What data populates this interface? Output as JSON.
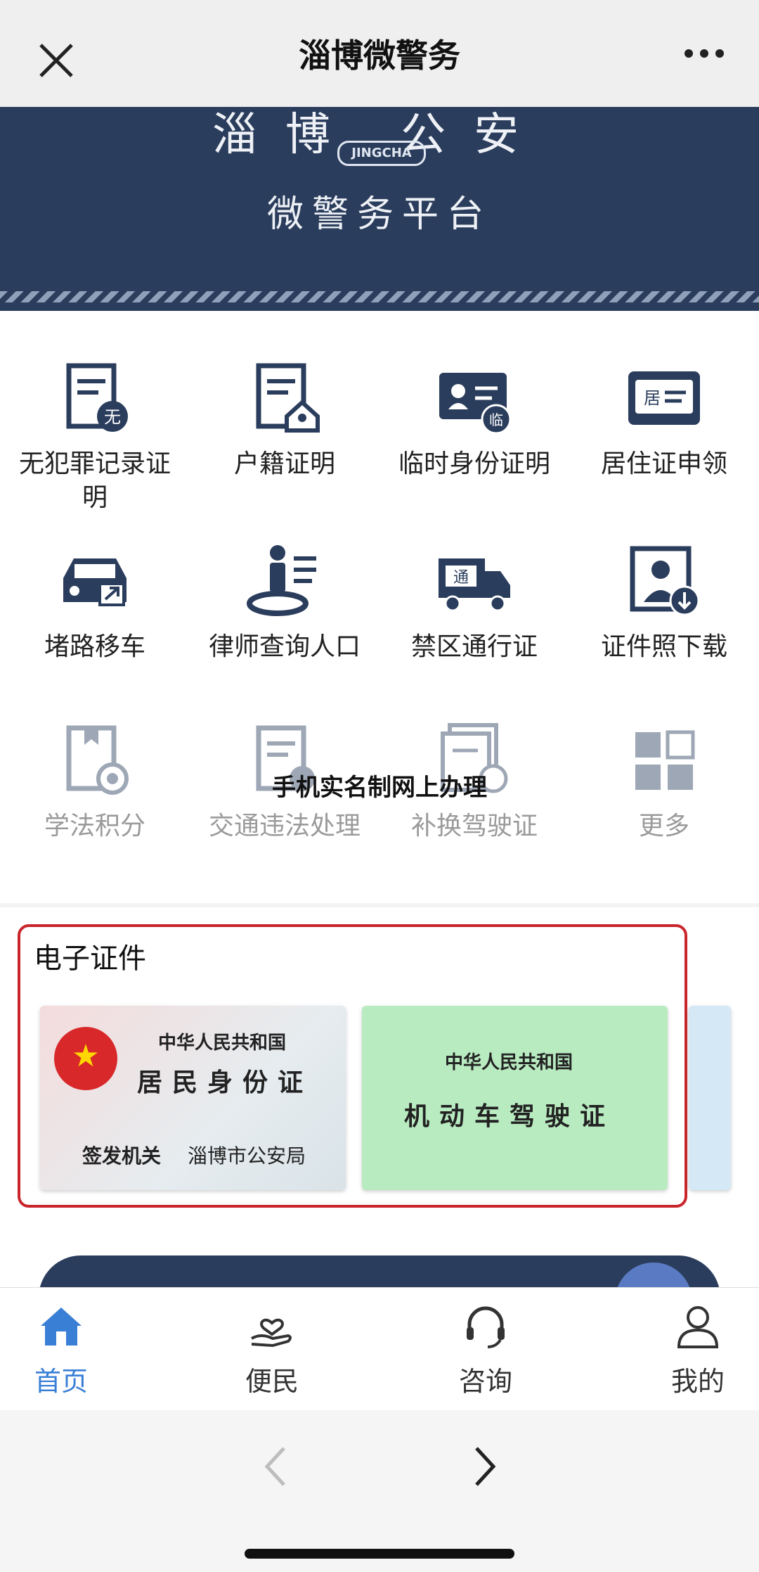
{
  "header": {
    "title": "淄博微警务",
    "close_icon": "close-icon",
    "more_icon": "more-icon"
  },
  "banner": {
    "line1": "淄博 公安",
    "badge": "JINGCHA",
    "line2": "微警务平台"
  },
  "services": [
    {
      "label": "无犯罪记录证明",
      "icon": "no-crime-record-icon"
    },
    {
      "label": "户籍证明",
      "icon": "household-cert-icon"
    },
    {
      "label": "临时身份证明",
      "icon": "temp-id-icon"
    },
    {
      "label": "居住证申领",
      "icon": "residence-permit-icon"
    },
    {
      "label": "堵路移车",
      "icon": "move-car-icon"
    },
    {
      "label": "律师查询人口",
      "icon": "lawyer-query-icon"
    },
    {
      "label": "禁区通行证",
      "icon": "truck-pass-icon"
    },
    {
      "label": "证件照下载",
      "icon": "photo-download-icon"
    },
    {
      "label": "学法积分",
      "icon": "law-points-icon"
    },
    {
      "label": "交通违法处理",
      "icon": "traffic-violation-icon"
    },
    {
      "label": "补换驾驶证",
      "icon": "license-replace-icon"
    },
    {
      "label": "更多",
      "icon": "more-grid-icon"
    }
  ],
  "overlay_caption": "手机实名制网上办理",
  "ecert": {
    "title": "电子证件",
    "id_card": {
      "country": "中华人民共和国",
      "name": "居民身份证",
      "issuer_label": "签发机关",
      "issuer": "淄博市公安局"
    },
    "license": {
      "country": "中华人民共和国",
      "name": "机动车驾驶证"
    }
  },
  "tabs": [
    {
      "label": "首页",
      "icon": "home-icon",
      "active": true
    },
    {
      "label": "便民",
      "icon": "service-hand-icon",
      "active": false
    },
    {
      "label": "咨询",
      "icon": "headset-icon",
      "active": false
    },
    {
      "label": "我的",
      "icon": "user-icon",
      "active": false
    }
  ],
  "colors": {
    "navy": "#2b3d5c",
    "accent_blue": "#3a7fd6",
    "cert_border": "#c9262c"
  }
}
